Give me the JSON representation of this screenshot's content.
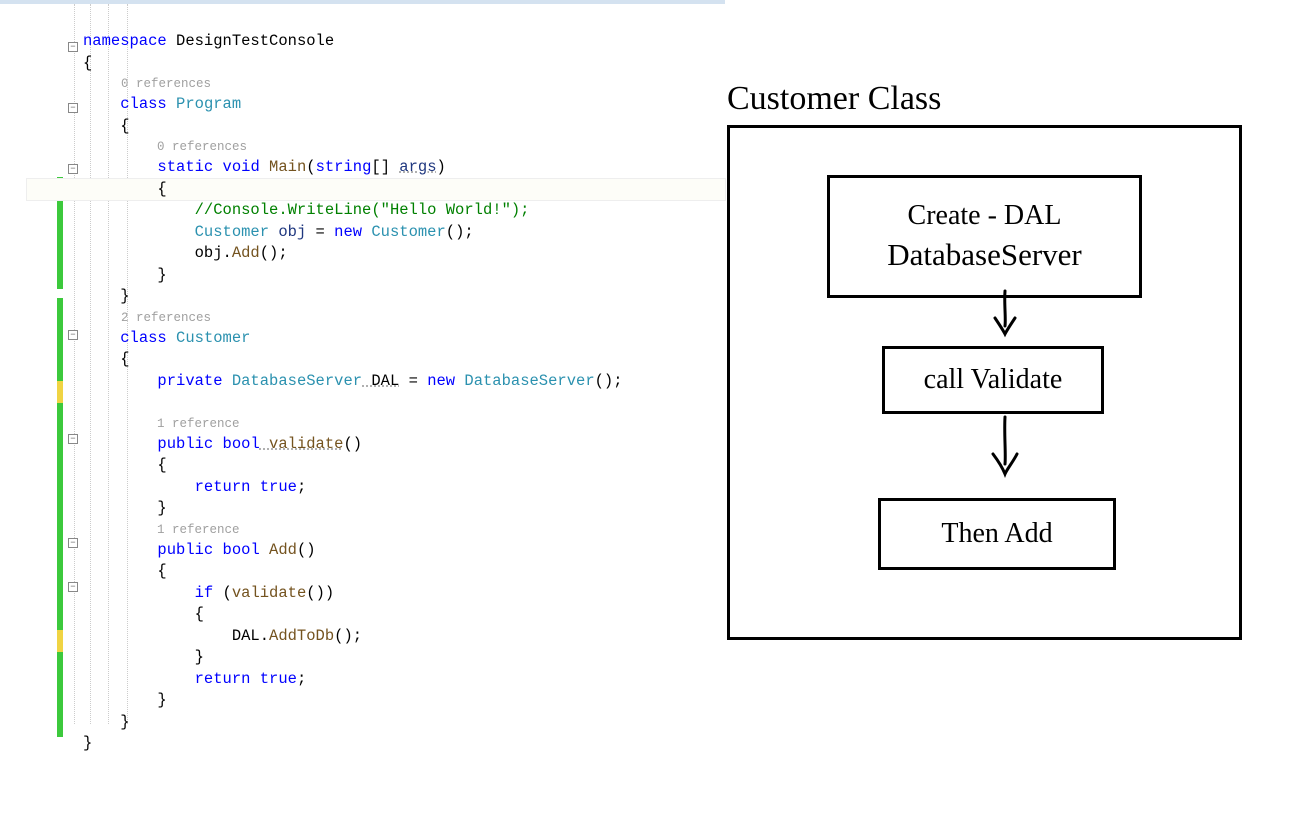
{
  "code": {
    "ref0a": "0 references",
    "ref0b": "0 references",
    "ref2": "2 references",
    "ref1a": "1 reference",
    "ref1b": "1 reference",
    "l1_kw": "namespace",
    "l1_name": " DesignTestConsole",
    "l2": "{",
    "l4_kw": "class",
    "l4_name": " Program",
    "l5": "    {",
    "l7_kw1": "static",
    "l7_kw2": " void",
    "l7_m": " Main",
    "l7_p1": "(",
    "l7_kw3": "string",
    "l7_p2": "[] ",
    "l7_arg": "args",
    "l7_p3": ")",
    "l8": "        {",
    "l9_cmt": "            //Console.WriteLine(\"Hello World!\");",
    "l10_type": "            Customer",
    "l10_var": " obj",
    "l10_eq": " = ",
    "l10_kw": "new",
    "l10_type2": " Customer",
    "l10_end": "();",
    "l11": "            obj.",
    "l11_m": "Add",
    "l11_end": "();",
    "l12": "        }",
    "l13": "    }",
    "l15_kw": "class",
    "l15_name": " Customer",
    "l16": "    {",
    "l17_kw": "        private",
    "l17_type": " DatabaseServer",
    "l17_var": " DAL",
    "l17_eq": " = ",
    "l17_kw2": "new",
    "l17_type2": " DatabaseServer",
    "l17_end": "();",
    "l19_kw": "        public",
    "l19_kw2": " bool",
    "l19_m": " validate",
    "l19_end": "()",
    "l20": "        {",
    "l21_kw": "            return",
    "l21_kw2": " true",
    "l21_end": ";",
    "l22": "        }",
    "l24_kw": "        public",
    "l24_kw2": " bool",
    "l24_m": " Add",
    "l24_end": "()",
    "l25": "        {",
    "l26_kw": "            if",
    "l26_p": " (",
    "l26_m": "validate",
    "l26_end": "())",
    "l27": "            {",
    "l28": "                DAL.",
    "l28_m": "AddToDb",
    "l28_end": "();",
    "l29": "            }",
    "l30_kw": "            return",
    "l30_kw2": " true",
    "l30_end": ";",
    "l31": "        }",
    "l32": "    }",
    "l33": "}"
  },
  "diagram": {
    "title": "Customer Class",
    "box1_line1": "Create - DAL",
    "box1_line2": "DatabaseServer",
    "box2": "call Validate",
    "box3": "Then Add"
  }
}
